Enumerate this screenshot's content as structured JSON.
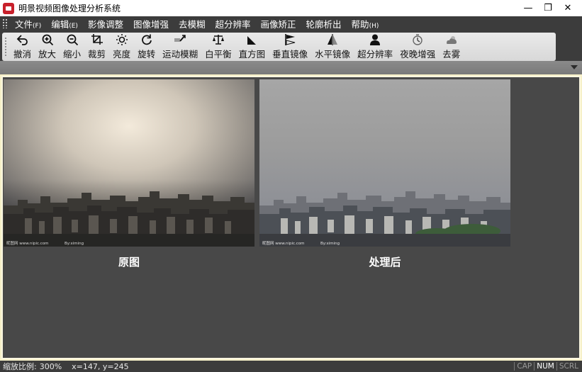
{
  "window": {
    "title": "明景视频图像处理分析系统",
    "controls": {
      "minimize": "—",
      "restore": "❐",
      "close": "✕"
    },
    "app_icon_color": "#c8202b"
  },
  "menu": [
    {
      "label": "文件",
      "accel": "(F)"
    },
    {
      "label": "编辑",
      "accel": "(E)"
    },
    {
      "label": "影像调整",
      "accel": ""
    },
    {
      "label": "图像增强",
      "accel": ""
    },
    {
      "label": "去模糊",
      "accel": ""
    },
    {
      "label": "超分辨率",
      "accel": ""
    },
    {
      "label": "画像矫正",
      "accel": ""
    },
    {
      "label": "轮廓析出",
      "accel": ""
    },
    {
      "label": "帮助",
      "accel": "(H)"
    }
  ],
  "toolbar": [
    {
      "label": "撤消",
      "icon": "undo-icon"
    },
    {
      "label": "放大",
      "icon": "zoom-in-icon"
    },
    {
      "label": "缩小",
      "icon": "zoom-out-icon"
    },
    {
      "label": "裁剪",
      "icon": "crop-icon"
    },
    {
      "label": "亮度",
      "icon": "brightness-icon"
    },
    {
      "label": "旋转",
      "icon": "rotate-icon"
    },
    {
      "label": "运动模糊",
      "icon": "motion-blur-icon"
    },
    {
      "label": "白平衡",
      "icon": "balance-icon"
    },
    {
      "label": "直方图",
      "icon": "histogram-icon"
    },
    {
      "label": "垂直镜像",
      "icon": "vertical-mirror-icon"
    },
    {
      "label": "水平镜像",
      "icon": "horizontal-mirror-icon"
    },
    {
      "label": "超分辨率",
      "icon": "super-resolution-icon"
    },
    {
      "label": "夜晚增强",
      "icon": "night-enhance-icon"
    },
    {
      "label": "去雾",
      "icon": "dehaze-icon"
    }
  ],
  "panels": {
    "original_caption": "原图",
    "processed_caption": "处理后",
    "watermark_left": "昵图网 www.nipic.com",
    "watermark_user": "By:ximing"
  },
  "status": {
    "zoom_label": "缩放比例:",
    "zoom_value": "300%",
    "coords": "x=147, y=245",
    "keys": [
      {
        "label": "CAP",
        "on": false
      },
      {
        "label": "NUM",
        "on": true
      },
      {
        "label": "SCRL",
        "on": false
      }
    ]
  },
  "colors": {
    "background": "#3c3c3c",
    "panel_border": "#f6f0c8",
    "canvas": "#484848",
    "caption": "#ffffff"
  }
}
